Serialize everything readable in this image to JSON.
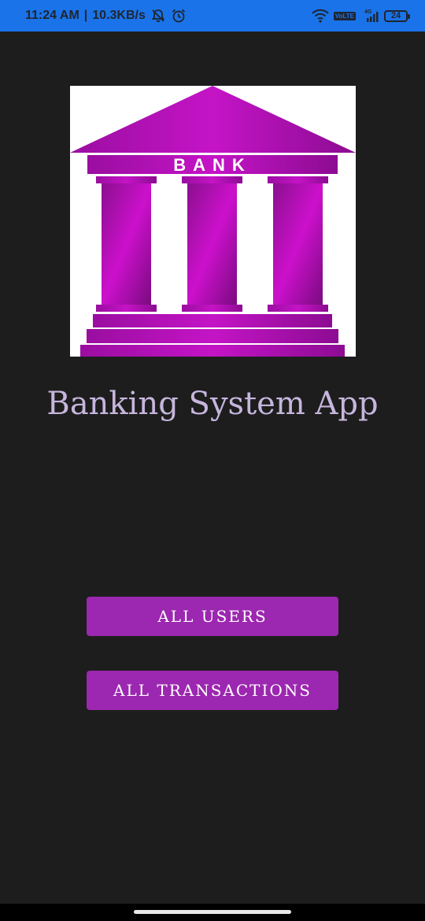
{
  "status_bar": {
    "time": "11:24 AM",
    "separator": "|",
    "speed": "10.3KB/s",
    "network": "4G",
    "volte": "VoLTE",
    "battery": "24",
    "icons": [
      "mute-notifications-icon",
      "alarm-icon",
      "wifi-icon",
      "volte-icon",
      "signal-icon",
      "battery-icon"
    ],
    "background_color": "#1a73e8"
  },
  "logo": {
    "text": "BANK",
    "color": "#b010b8"
  },
  "title": "Banking System App",
  "buttons": {
    "all_users": "ALL USERS",
    "all_transactions": "ALL TRANSACTIONS"
  },
  "colors": {
    "background": "#1d1d1d",
    "button": "#9c27b0",
    "title": "#c6b6dd"
  }
}
